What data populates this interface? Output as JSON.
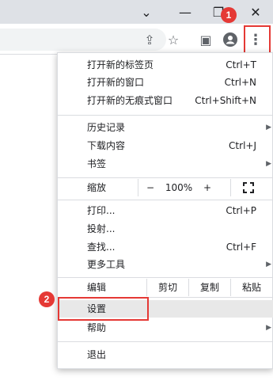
{
  "window": {
    "minimize_icon": "chevron-down-icon",
    "restore_icon": "restore-icon",
    "close_icon": "close-icon",
    "dash": "—",
    "restore": "❐",
    "close": "✕",
    "chevron": "⌄"
  },
  "toolbar": {
    "share": "⇪",
    "star": "☆",
    "sidepanel": "▣",
    "profile": "●",
    "menu": "⋮"
  },
  "annotations": {
    "step1": "1",
    "step2": "2",
    "color": "#e53935"
  },
  "menu": {
    "new_tab": {
      "label": "打开新的标签页",
      "shortcut": "Ctrl+T"
    },
    "new_window": {
      "label": "打开新的窗口",
      "shortcut": "Ctrl+N"
    },
    "incognito": {
      "label": "打开新的无痕式窗口",
      "shortcut": "Ctrl+Shift+N"
    },
    "history": {
      "label": "历史记录"
    },
    "downloads": {
      "label": "下载内容",
      "shortcut": "Ctrl+J"
    },
    "bookmarks": {
      "label": "书签"
    },
    "zoom": {
      "label": "缩放",
      "minus": "−",
      "value": "100%",
      "plus": "+",
      "fullscreen": "⛶"
    },
    "print": {
      "label": "打印...",
      "shortcut": "Ctrl+P"
    },
    "cast": {
      "label": "投射..."
    },
    "find": {
      "label": "查找...",
      "shortcut": "Ctrl+F"
    },
    "more_tools": {
      "label": "更多工具"
    },
    "edit": {
      "label": "编辑",
      "cut": "剪切",
      "copy": "复制",
      "paste": "粘贴"
    },
    "settings": {
      "label": "设置"
    },
    "help": {
      "label": "帮助"
    },
    "exit": {
      "label": "退出"
    },
    "submenu_arrow": "▶"
  }
}
